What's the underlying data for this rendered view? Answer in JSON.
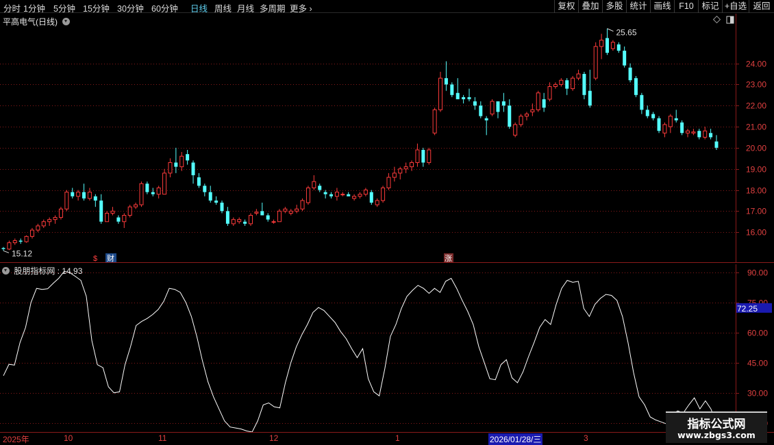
{
  "toolbar": {
    "periods": [
      "分时",
      "1分钟",
      "5分钟",
      "15分钟",
      "30分钟",
      "60分钟",
      "日线",
      "周线",
      "月线",
      "多周期",
      "更多"
    ],
    "active_period": "日线",
    "tools": [
      "复权",
      "叠加",
      "多股",
      "统计",
      "画线",
      "F10",
      "标记",
      "+自选",
      "返回"
    ]
  },
  "price_pane": {
    "title": "平高电气(日线)",
    "high_label": "25.65",
    "low_label": "15.12",
    "event_markers": [
      "$",
      "财",
      "涨"
    ]
  },
  "indicator_pane": {
    "title": "股朋指标网",
    "value": "14.93",
    "current_tag": "72.25"
  },
  "date_axis": {
    "labels": [
      "2025年",
      "10",
      "11",
      "12",
      "1",
      "2026/01/28/三",
      "3"
    ]
  },
  "watermark": {
    "title": "指标公式网",
    "url": "www.zbgs3.com"
  },
  "colors": {
    "up": "#ff3b3b",
    "down": "#54ffff",
    "grid": "#8b1a1a",
    "line": "#ffffff",
    "active": "#5fd0f0"
  },
  "chart_data": [
    {
      "type": "candlestick",
      "title": "平高电气(日线)",
      "y_ticks": [
        16.0,
        17.0,
        18.0,
        19.0,
        20.0,
        21.0,
        22.0,
        23.0,
        24.0
      ],
      "ylim": [
        15.0,
        25.9
      ],
      "x_labels": [
        "2025年",
        "10",
        "11",
        "12",
        "1",
        "2026/01/28/三",
        "3"
      ],
      "ohlc": [
        [
          15.25,
          15.3,
          15.12,
          15.2
        ],
        [
          15.2,
          15.6,
          15.15,
          15.5
        ],
        [
          15.5,
          15.7,
          15.4,
          15.6
        ],
        [
          15.6,
          15.7,
          15.45,
          15.55
        ],
        [
          15.55,
          15.85,
          15.5,
          15.8
        ],
        [
          15.8,
          16.2,
          15.7,
          16.1
        ],
        [
          16.1,
          16.4,
          16.0,
          16.3
        ],
        [
          16.3,
          16.6,
          16.2,
          16.5
        ],
        [
          16.5,
          16.7,
          16.3,
          16.6
        ],
        [
          16.6,
          16.8,
          16.4,
          16.7
        ],
        [
          16.7,
          17.2,
          16.6,
          17.1
        ],
        [
          17.1,
          18.0,
          17.0,
          17.9
        ],
        [
          17.9,
          18.1,
          17.6,
          17.7
        ],
        [
          17.7,
          18.0,
          17.5,
          17.9
        ],
        [
          17.9,
          18.3,
          17.5,
          17.6
        ],
        [
          17.6,
          18.1,
          17.5,
          17.9
        ],
        [
          17.7,
          17.8,
          17.2,
          17.5
        ],
        [
          17.5,
          17.8,
          16.4,
          16.5
        ],
        [
          16.5,
          17.0,
          16.5,
          16.9
        ],
        [
          16.9,
          17.2,
          16.8,
          17.0
        ],
        [
          16.7,
          16.8,
          16.4,
          16.5
        ],
        [
          16.5,
          16.9,
          16.2,
          16.8
        ],
        [
          16.8,
          17.3,
          16.7,
          17.2
        ],
        [
          17.2,
          17.4,
          17.1,
          17.3
        ],
        [
          17.3,
          18.4,
          17.2,
          18.3
        ],
        [
          18.3,
          18.4,
          17.8,
          17.9
        ],
        [
          17.9,
          18.1,
          17.7,
          17.8
        ],
        [
          17.8,
          18.2,
          17.6,
          18.1
        ],
        [
          17.8,
          19.0,
          17.8,
          18.8
        ],
        [
          18.8,
          19.5,
          18.6,
          19.3
        ],
        [
          19.3,
          20.0,
          18.8,
          19.1
        ],
        [
          19.1,
          19.8,
          18.9,
          19.6
        ],
        [
          19.7,
          19.9,
          19.2,
          19.4
        ],
        [
          19.3,
          19.4,
          18.3,
          18.7
        ],
        [
          18.6,
          18.8,
          18.1,
          18.2
        ],
        [
          18.2,
          18.3,
          17.7,
          17.9
        ],
        [
          17.9,
          18.2,
          17.4,
          17.5
        ],
        [
          17.5,
          17.7,
          17.3,
          17.4
        ],
        [
          17.4,
          17.5,
          16.9,
          17.0
        ],
        [
          17.0,
          17.2,
          16.3,
          16.4
        ],
        [
          16.4,
          16.7,
          16.3,
          16.6
        ],
        [
          16.5,
          16.7,
          16.4,
          16.6
        ],
        [
          16.5,
          16.6,
          16.3,
          16.4
        ],
        [
          16.4,
          16.9,
          16.3,
          16.8
        ],
        [
          16.9,
          17.1,
          16.8,
          16.95
        ],
        [
          17.0,
          17.4,
          16.8,
          16.8
        ],
        [
          16.8,
          16.9,
          16.5,
          16.6
        ],
        [
          16.5,
          16.6,
          16.4,
          16.5
        ],
        [
          16.5,
          17.1,
          16.5,
          17.0
        ],
        [
          17.0,
          17.2,
          16.9,
          17.1
        ],
        [
          16.9,
          17.1,
          16.8,
          17.0
        ],
        [
          17.0,
          17.3,
          16.9,
          17.1
        ],
        [
          17.1,
          17.6,
          17.0,
          17.5
        ],
        [
          17.4,
          18.2,
          17.3,
          18.1
        ],
        [
          18.1,
          18.7,
          18.0,
          18.4
        ],
        [
          18.2,
          18.3,
          17.9,
          18.0
        ],
        [
          17.9,
          18.0,
          17.6,
          17.8
        ],
        [
          17.8,
          17.9,
          17.6,
          17.7
        ],
        [
          17.7,
          18.1,
          17.5,
          17.9
        ],
        [
          17.8,
          17.9,
          17.7,
          17.8
        ],
        [
          17.8,
          17.9,
          17.7,
          17.7
        ],
        [
          17.6,
          17.8,
          17.5,
          17.7
        ],
        [
          17.7,
          17.9,
          17.6,
          17.8
        ],
        [
          17.8,
          18.1,
          17.7,
          18.0
        ],
        [
          17.9,
          18.0,
          17.3,
          17.4
        ],
        [
          17.3,
          17.6,
          17.2,
          17.5
        ],
        [
          17.5,
          18.2,
          17.4,
          18.1
        ],
        [
          18.1,
          18.8,
          18.0,
          18.6
        ],
        [
          18.6,
          19.1,
          18.4,
          18.8
        ],
        [
          18.8,
          19.1,
          18.5,
          19.0
        ],
        [
          19.0,
          19.3,
          18.8,
          19.1
        ],
        [
          19.1,
          19.4,
          18.9,
          19.3
        ],
        [
          19.3,
          20.2,
          19.1,
          19.9
        ],
        [
          19.9,
          20.0,
          19.1,
          19.3
        ],
        [
          19.3,
          20.0,
          19.2,
          19.9
        ],
        [
          20.7,
          21.9,
          20.6,
          21.8
        ],
        [
          21.8,
          23.6,
          21.7,
          23.3
        ],
        [
          23.3,
          24.1,
          22.7,
          23.0
        ],
        [
          23.0,
          23.1,
          22.4,
          22.5
        ],
        [
          22.6,
          23.3,
          22.3,
          22.3
        ],
        [
          22.4,
          22.5,
          22.1,
          22.3
        ],
        [
          22.4,
          22.8,
          22.2,
          22.3
        ],
        [
          22.2,
          22.4,
          21.8,
          22.0
        ],
        [
          22.0,
          22.2,
          21.4,
          21.5
        ],
        [
          21.4,
          21.5,
          20.6,
          21.3
        ],
        [
          21.6,
          22.3,
          21.5,
          22.2
        ],
        [
          22.2,
          22.2,
          21.4,
          21.7
        ],
        [
          22.2,
          22.6,
          21.7,
          22.0
        ],
        [
          22.0,
          22.3,
          20.9,
          21.0
        ],
        [
          20.6,
          21.2,
          20.5,
          21.1
        ],
        [
          21.1,
          21.6,
          21.0,
          21.5
        ],
        [
          21.5,
          21.7,
          21.3,
          21.6
        ],
        [
          21.7,
          22.1,
          21.5,
          21.8
        ],
        [
          21.8,
          22.7,
          21.7,
          22.6
        ],
        [
          22.3,
          22.6,
          21.7,
          21.9
        ],
        [
          22.3,
          23.1,
          22.2,
          22.9
        ],
        [
          22.9,
          23.1,
          22.8,
          23.0
        ],
        [
          23.0,
          23.3,
          22.9,
          23.2
        ],
        [
          23.2,
          23.3,
          22.5,
          22.8
        ],
        [
          22.8,
          23.4,
          22.7,
          23.3
        ],
        [
          23.3,
          23.7,
          23.2,
          23.5
        ],
        [
          23.5,
          23.6,
          22.3,
          22.5
        ],
        [
          22.7,
          23.7,
          21.9,
          22.0
        ],
        [
          23.3,
          25.0,
          23.2,
          24.8
        ],
        [
          24.8,
          25.4,
          24.2,
          25.1
        ],
        [
          25.2,
          25.65,
          24.4,
          24.5
        ],
        [
          24.7,
          25.1,
          24.6,
          25.0
        ],
        [
          24.9,
          25.0,
          24.5,
          24.6
        ],
        [
          24.6,
          24.8,
          23.8,
          23.9
        ],
        [
          23.8,
          24.0,
          23.1,
          23.2
        ],
        [
          23.3,
          23.4,
          22.4,
          22.5
        ],
        [
          22.5,
          22.6,
          21.6,
          21.8
        ],
        [
          21.8,
          22.0,
          21.4,
          21.5
        ],
        [
          21.6,
          21.7,
          21.3,
          21.4
        ],
        [
          21.4,
          21.5,
          20.7,
          20.8
        ],
        [
          20.7,
          21.2,
          20.5,
          21.1
        ],
        [
          21.0,
          21.6,
          20.7,
          21.5
        ],
        [
          21.4,
          21.8,
          21.2,
          21.3
        ],
        [
          21.2,
          21.3,
          20.6,
          20.7
        ],
        [
          20.7,
          20.9,
          20.5,
          20.8
        ],
        [
          20.7,
          20.9,
          20.6,
          20.75
        ],
        [
          20.8,
          20.9,
          20.4,
          20.5
        ],
        [
          20.5,
          21.0,
          20.4,
          20.8
        ],
        [
          20.7,
          20.9,
          20.4,
          20.5
        ],
        [
          20.3,
          20.6,
          19.9,
          20.0
        ]
      ]
    },
    {
      "type": "line",
      "title": "股朋指标网",
      "y_ticks": [
        15.0,
        30.0,
        45.0,
        60.0,
        75.0,
        90.0
      ],
      "ylim": [
        10.5,
        94.0
      ],
      "series": [
        {
          "values": [
            38.5,
            44.2,
            43.8,
            55.0,
            62.5,
            75.0,
            82.0,
            81.5,
            81.8,
            84.5,
            87.0,
            90.5,
            89.8,
            88.0,
            86.0,
            78.0,
            56.0,
            44.0,
            42.5,
            33.0,
            30.0,
            30.5,
            44.0,
            53.0,
            63.5,
            65.5,
            67.0,
            69.0,
            71.5,
            75.5,
            82.0,
            81.5,
            80.0,
            75.0,
            68.0,
            58.0,
            46.0,
            35.5,
            28.0,
            22.0,
            16.0,
            13.0,
            12.5,
            12.0,
            11.0,
            10.5,
            16.0,
            24.0,
            25.0,
            23.0,
            22.5,
            35.0,
            45.0,
            53.0,
            59.0,
            64.0,
            70.0,
            72.5,
            71.0,
            68.0,
            65.0,
            60.5,
            57.0,
            52.0,
            47.5,
            52.0,
            37.0,
            30.5,
            28.5,
            42.0,
            58.0,
            64.0,
            72.0,
            78.0,
            81.0,
            83.5,
            82.0,
            79.5,
            82.0,
            80.0,
            85.5,
            87.0,
            82.0,
            76.0,
            70.5,
            64.0,
            53.0,
            45.0,
            37.0,
            36.5,
            44.0,
            46.5,
            37.5,
            35.0,
            40.5,
            48.0,
            55.0,
            62.5,
            66.5,
            64.0,
            74.0,
            82.0,
            86.0,
            85.0,
            85.5,
            72.0,
            68.0,
            74.0,
            77.0,
            79.0,
            78.5,
            76.0,
            68.0,
            55.0,
            40.0,
            28.0,
            24.0,
            18.0,
            16.5,
            15.5,
            14.5,
            19.5,
            21.0,
            20.0,
            24.0,
            27.5,
            22.0,
            26.0,
            22.0,
            14.93
          ]
        }
      ]
    }
  ]
}
